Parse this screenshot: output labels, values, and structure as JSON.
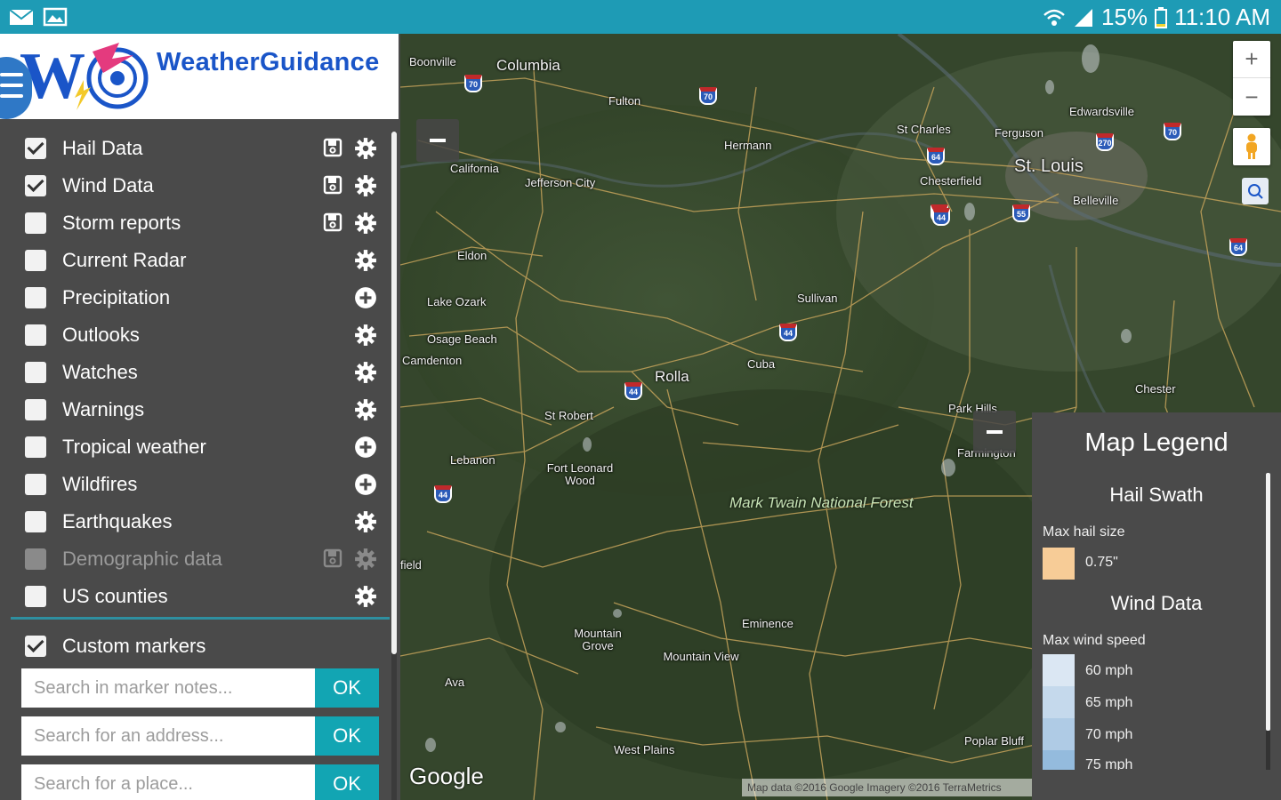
{
  "status_bar": {
    "battery": "15%",
    "time": "11:10 AM"
  },
  "brand": {
    "name": "WeatherGuidance"
  },
  "layers": [
    {
      "label": "Hail Data",
      "checked": true,
      "disabled": false,
      "actions": [
        "save-icon",
        "gear-icon"
      ]
    },
    {
      "label": "Wind Data",
      "checked": true,
      "disabled": false,
      "actions": [
        "save-icon",
        "gear-icon"
      ]
    },
    {
      "label": "Storm reports",
      "checked": false,
      "disabled": false,
      "actions": [
        "save-icon",
        "gear-icon"
      ]
    },
    {
      "label": "Current Radar",
      "checked": false,
      "disabled": false,
      "actions": [
        "gear-icon"
      ]
    },
    {
      "label": "Precipitation",
      "checked": false,
      "disabled": false,
      "actions": [
        "plus-circle-icon"
      ]
    },
    {
      "label": "Outlooks",
      "checked": false,
      "disabled": false,
      "actions": [
        "gear-icon"
      ]
    },
    {
      "label": "Watches",
      "checked": false,
      "disabled": false,
      "actions": [
        "gear-icon"
      ]
    },
    {
      "label": "Warnings",
      "checked": false,
      "disabled": false,
      "actions": [
        "gear-icon"
      ]
    },
    {
      "label": "Tropical weather",
      "checked": false,
      "disabled": false,
      "actions": [
        "plus-circle-icon"
      ]
    },
    {
      "label": "Wildfires",
      "checked": false,
      "disabled": false,
      "actions": [
        "plus-circle-icon"
      ]
    },
    {
      "label": "Earthquakes",
      "checked": false,
      "disabled": false,
      "actions": [
        "gear-icon"
      ]
    },
    {
      "label": "Demographic data",
      "checked": false,
      "disabled": true,
      "actions": [
        "save-icon",
        "gear-icon"
      ]
    },
    {
      "label": "US counties",
      "checked": false,
      "disabled": false,
      "actions": [
        "gear-icon"
      ]
    }
  ],
  "custom_markers": {
    "label": "Custom markers",
    "checked": true
  },
  "searches": [
    {
      "placeholder": "Search in marker notes...",
      "button": "OK"
    },
    {
      "placeholder": "Search for an address...",
      "button": "OK"
    },
    {
      "placeholder": "Search for a place...",
      "button": "OK"
    }
  ],
  "map": {
    "cities": [
      {
        "name": "Boonville",
        "size": "small"
      },
      {
        "name": "Columbia",
        "size": "med"
      },
      {
        "name": "Fulton",
        "size": "small"
      },
      {
        "name": "Hermann",
        "size": "small"
      },
      {
        "name": "California",
        "size": "small"
      },
      {
        "name": "Jefferson City",
        "size": "small"
      },
      {
        "name": "St Charles",
        "size": "small"
      },
      {
        "name": "Ferguson",
        "size": "small"
      },
      {
        "name": "Edwardsville",
        "size": "small"
      },
      {
        "name": "St. Louis",
        "size": "big"
      },
      {
        "name": "Chesterfield",
        "size": "small"
      },
      {
        "name": "Belleville",
        "size": "small"
      },
      {
        "name": "Eldon",
        "size": "small"
      },
      {
        "name": "Lake Ozark",
        "size": "small"
      },
      {
        "name": "Osage Beach",
        "size": "small"
      },
      {
        "name": "Camdenton",
        "size": "small"
      },
      {
        "name": "Sullivan",
        "size": "small"
      },
      {
        "name": "Cuba",
        "size": "small"
      },
      {
        "name": "Rolla",
        "size": "med"
      },
      {
        "name": "St Robert",
        "size": "small"
      },
      {
        "name": "Chester",
        "size": "small"
      },
      {
        "name": "Park Hills",
        "size": "small"
      },
      {
        "name": "Farmington",
        "size": "small"
      },
      {
        "name": "Lebanon",
        "size": "small"
      },
      {
        "name": "Fort Leonard Wood",
        "size": "small"
      },
      {
        "name": "Mountain Grove",
        "size": "small"
      },
      {
        "name": "Mountain View",
        "size": "small"
      },
      {
        "name": "Eminence",
        "size": "small"
      },
      {
        "name": "Ava",
        "size": "small"
      },
      {
        "name": "West Plains",
        "size": "small"
      },
      {
        "name": "Poplar Bluff",
        "size": "small"
      },
      {
        "name": "field",
        "size": "small"
      }
    ],
    "forest_label": "Mark Twain National Forest",
    "shields": [
      "70",
      "70",
      "64",
      "270",
      "70",
      "44",
      "44",
      "55",
      "64",
      "44",
      "44",
      "44"
    ],
    "zoom_in": "+",
    "zoom_out": "−",
    "logo": "Google",
    "attribution": "Map data ©2016 Google Imagery ©2016 TerraMetrics"
  },
  "legend": {
    "title": "Map Legend",
    "sections": [
      {
        "title": "Hail Swath",
        "subtitle": "Max hail size",
        "items": [
          {
            "label": "0.75\"",
            "color": "#f7cc97"
          }
        ]
      },
      {
        "title": "Wind Data",
        "subtitle": "Max wind speed",
        "items": [
          {
            "label": "60 mph",
            "color": "#dbe7f3"
          },
          {
            "label": "65 mph",
            "color": "#c5d9ec"
          },
          {
            "label": "70 mph",
            "color": "#afcbe5"
          },
          {
            "label": "75 mph",
            "color": "#94bbdd"
          }
        ]
      }
    ]
  },
  "colors": {
    "status_bar": "#1e9bb5",
    "sidebar_bg": "#4a4a4a",
    "accent": "#12a5b3",
    "brand_blue": "#1a55c8"
  }
}
